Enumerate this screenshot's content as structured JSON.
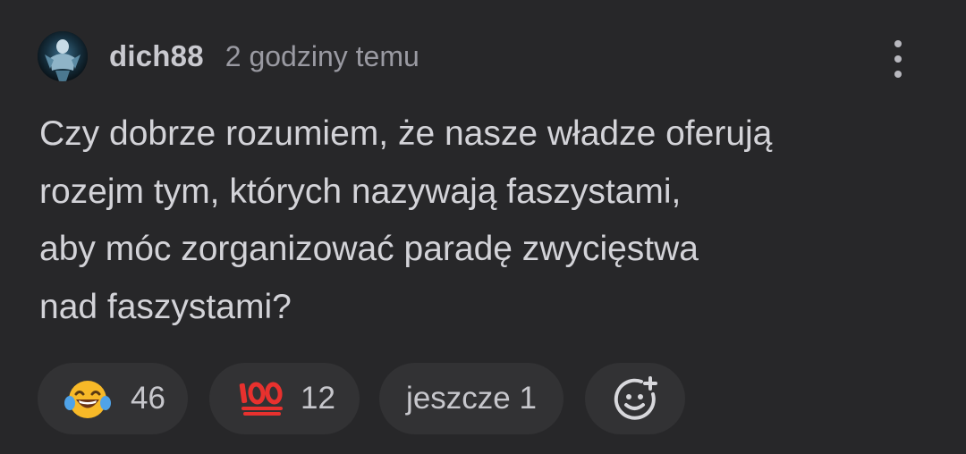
{
  "comment": {
    "author": "dich88",
    "timestamp": "2 godziny temu",
    "text_lines": [
      "Czy dobrze rozumiem, że nasze władze oferują",
      "rozejm tym, których nazywają faszystami,",
      "aby móc zorganizować paradę zwycięstwa",
      "nad faszystami?"
    ]
  },
  "reactions": [
    {
      "icon": "laughing-with-tears-emoji",
      "count": "46"
    },
    {
      "icon": "hundred-points-emoji",
      "count": "12"
    }
  ],
  "more_reactions_label": "jeszcze 1",
  "add_reaction_icon": "add-emoji-icon",
  "menu_icon": "vertical-ellipsis-icon",
  "colors": {
    "background": "#272729",
    "pill": "#323234",
    "text": "#d3d3d8",
    "muted": "#9a9aa2",
    "hundred_red": "#e8312e"
  }
}
